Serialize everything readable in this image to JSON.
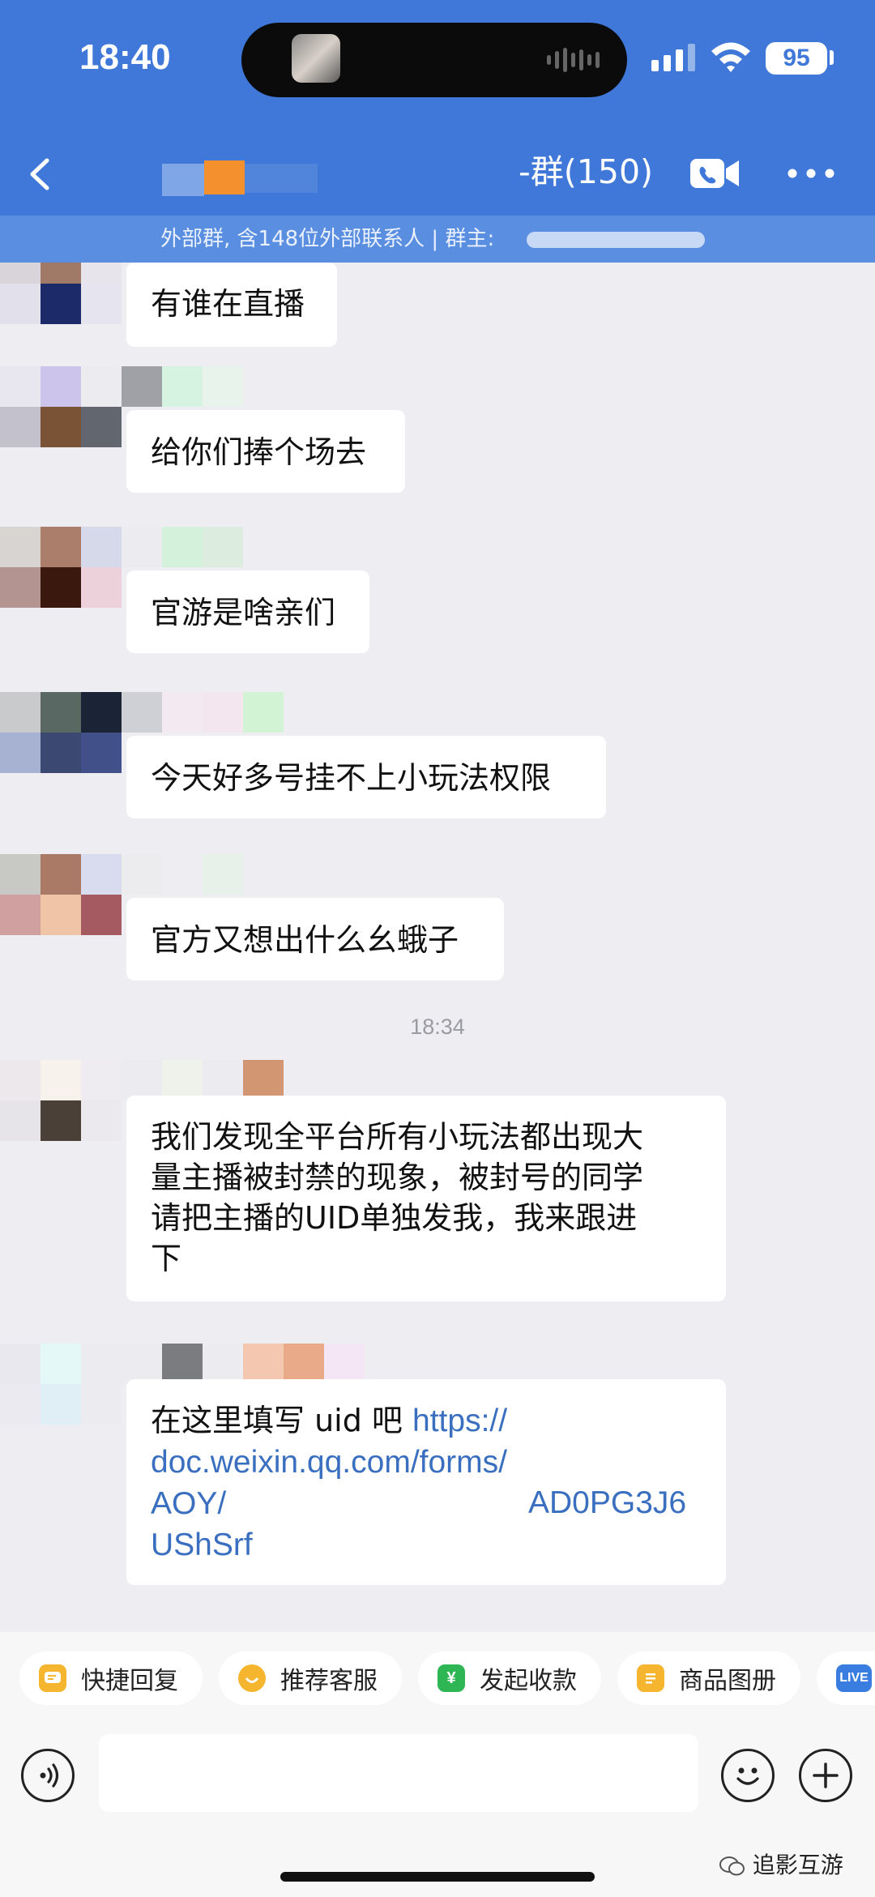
{
  "status_bar": {
    "time": "18:40",
    "battery": "95"
  },
  "header": {
    "group_title": "-群(150)",
    "subtitle": "外部群, 含148位外部联系人 | 群主:"
  },
  "colors": {
    "header": "#3f78d8",
    "link": "#3a6fc0",
    "background": "#ededf2"
  },
  "messages": [
    {
      "text": "有谁在直播"
    },
    {
      "text": "给你们捧个场去"
    },
    {
      "text": "官游是啥亲们"
    },
    {
      "text": "今天好多号挂不上小玩法权限"
    },
    {
      "text": "官方又想出什么幺蛾子"
    },
    {
      "lines": [
        "我们发现全平台所有小玩法都出现大",
        "量主播被封禁的现象，被封号的同学",
        "请把主播的UID单独发我，我来跟进",
        "下"
      ]
    },
    {
      "prefix": "在这里填写 uid 吧 ",
      "link_lines": [
        "https://",
        "doc.weixin.qq.com/forms/",
        "AOY/",
        "AD0PG3J6",
        "UShSrf"
      ]
    }
  ],
  "timestamp": "18:34",
  "quick_actions": [
    {
      "label": "快捷回复",
      "icon": "quick-reply-icon",
      "color": "#f5b52e"
    },
    {
      "label": "推荐客服",
      "icon": "recommend-service-icon",
      "color": "#f5b52e"
    },
    {
      "label": "发起收款",
      "icon": "payment-icon",
      "color": "#2fb654",
      "glyph": "¥"
    },
    {
      "label": "商品图册",
      "icon": "catalog-icon",
      "color": "#f5b52e"
    },
    {
      "label": "LIVE",
      "icon": "live-icon",
      "color": "#3a7de0"
    }
  ],
  "input": {
    "placeholder": ""
  },
  "watermark": "追影互游"
}
